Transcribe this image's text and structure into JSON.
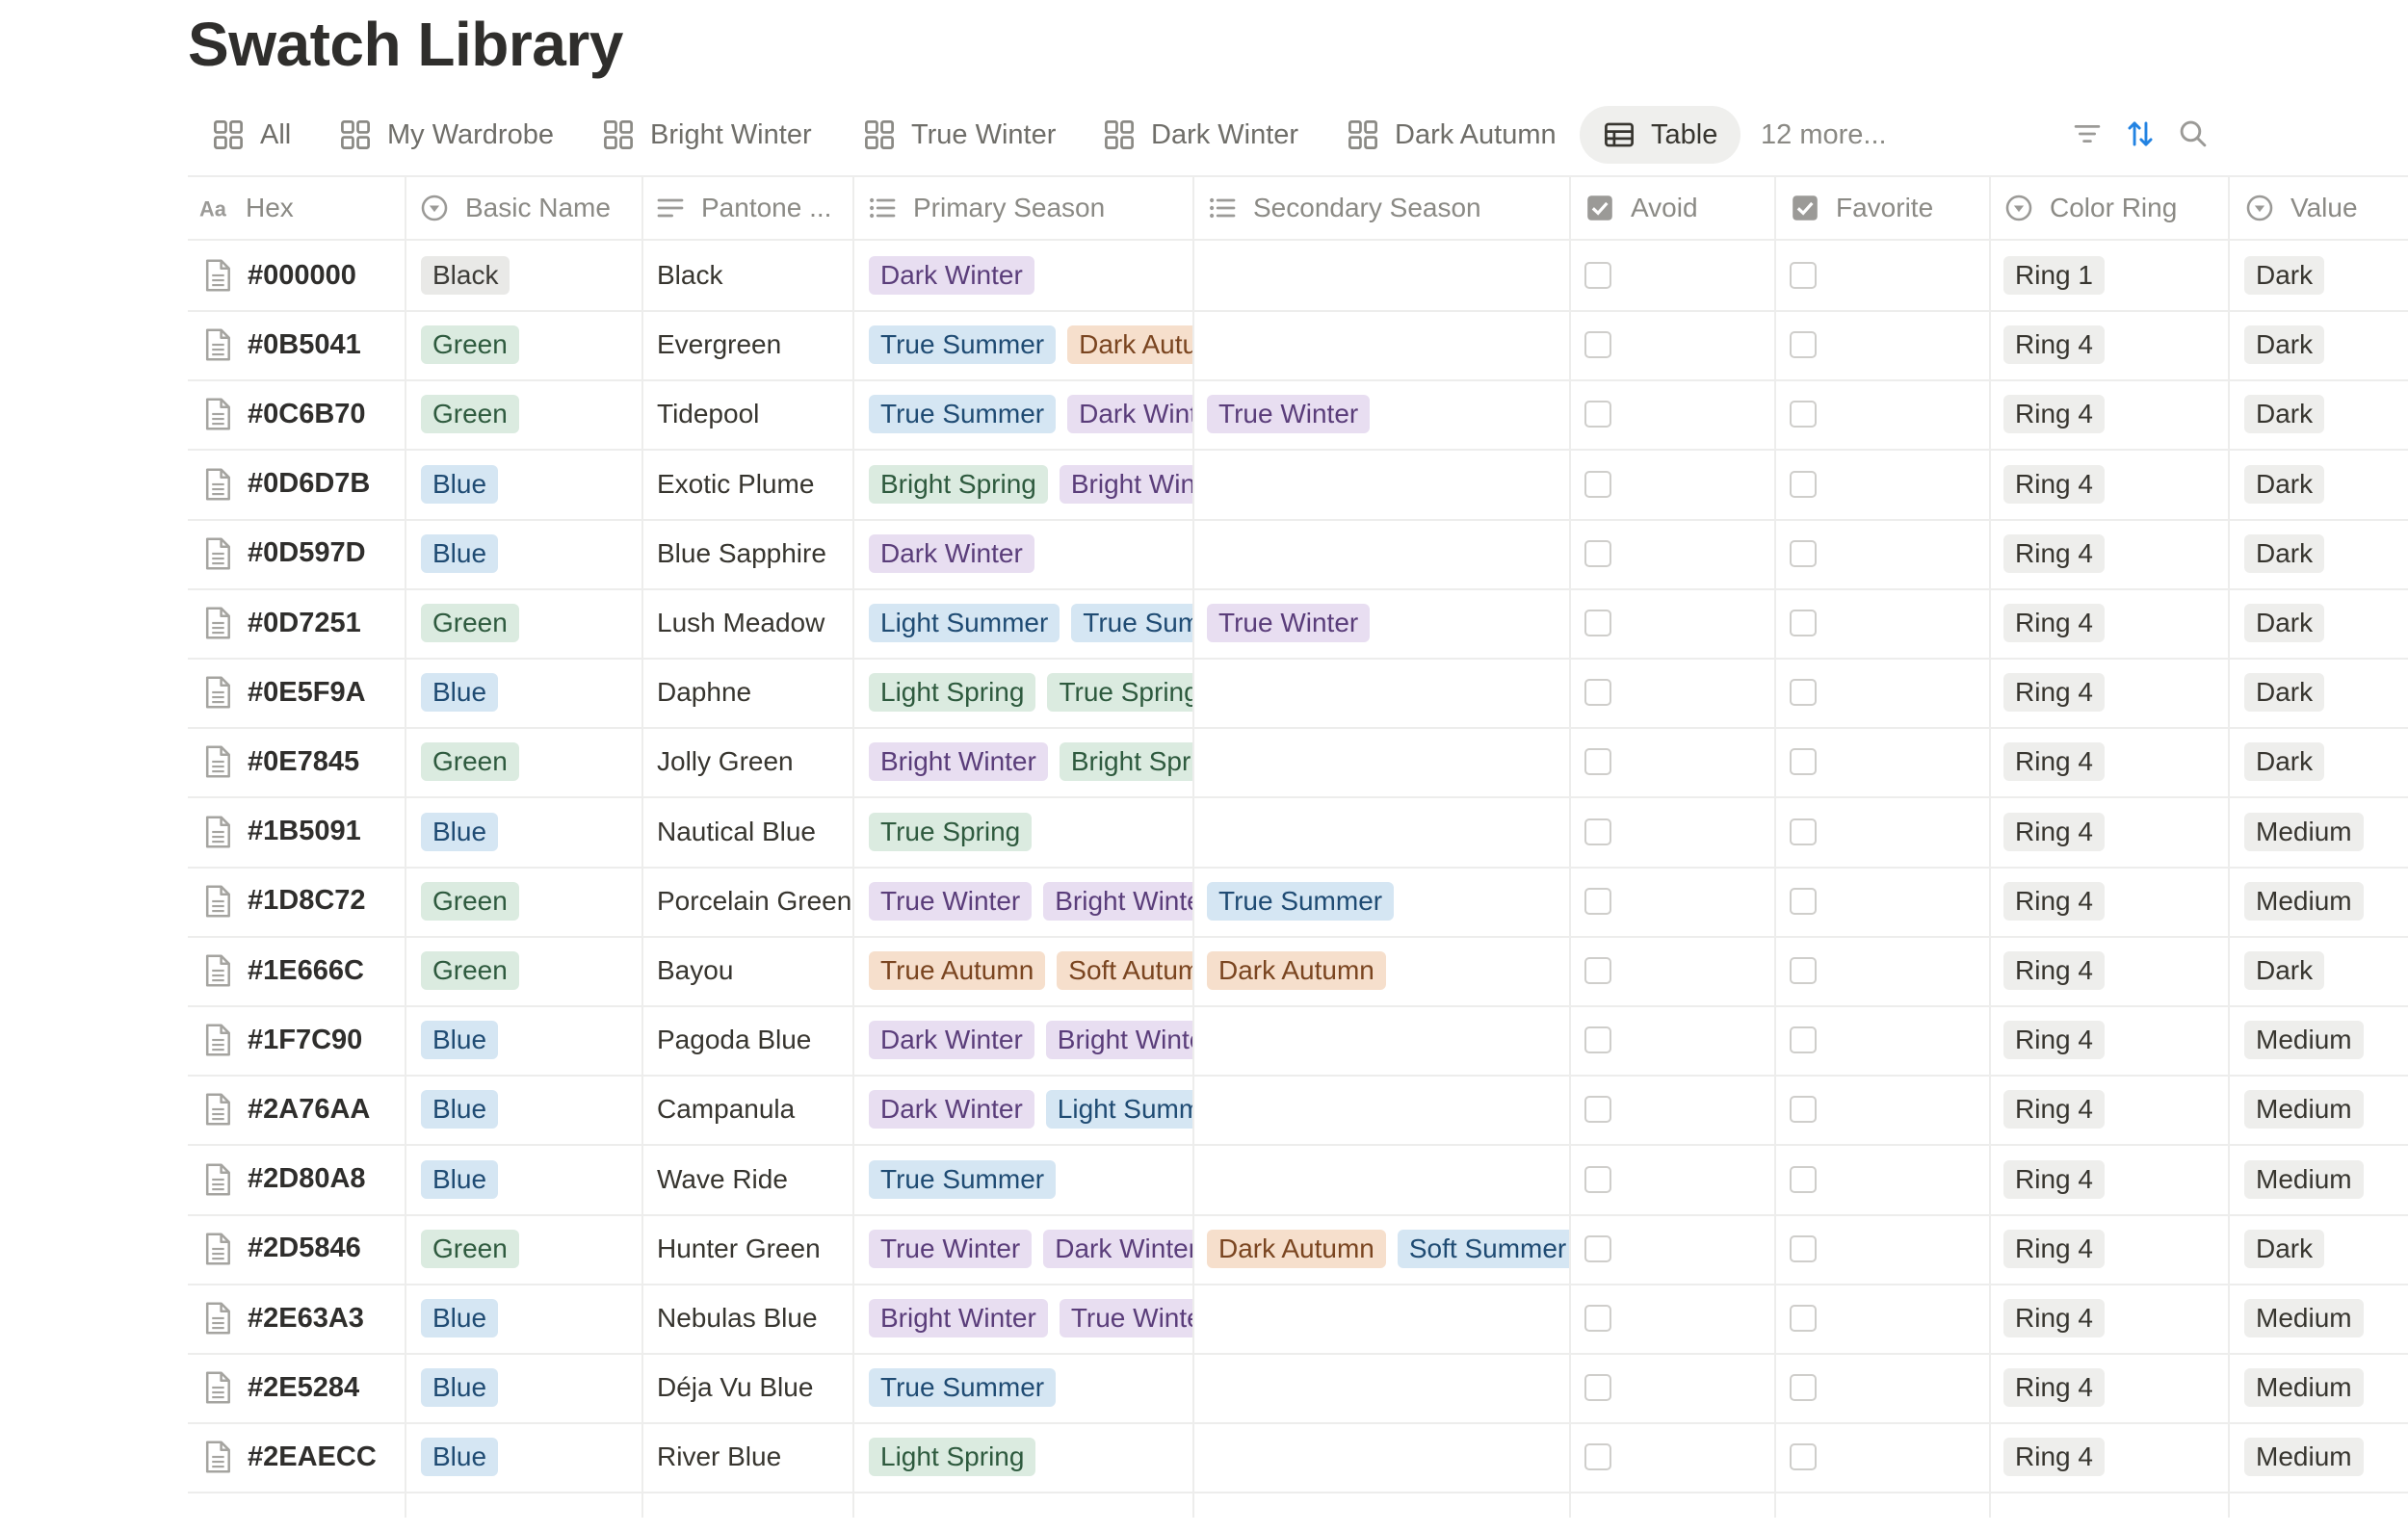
{
  "page": {
    "title": "Swatch Library"
  },
  "views": {
    "tabs": [
      "All",
      "My Wardrobe",
      "Bright Winter",
      "True Winter",
      "Dark Winter",
      "Dark Autumn"
    ],
    "active": "Table",
    "more": "12 more..."
  },
  "columns": {
    "hex": "Hex",
    "basic_name": "Basic Name",
    "pantone": "Pantone ...",
    "primary_season": "Primary Season",
    "secondary_season": "Secondary Season",
    "avoid": "Avoid",
    "favorite": "Favorite",
    "color_ring": "Color Ring",
    "value": "Value"
  },
  "colors": {
    "green": "#dbebe0",
    "blue": "#d5e6f3",
    "gray": "#e9e9e7",
    "purple": "#e8def1",
    "orange": "#f6dfcc",
    "accent": "#2383e2"
  },
  "rows": [
    {
      "hex": "#000000",
      "basic": "Black",
      "pantone": "Black",
      "primary": [
        "Dark Winter"
      ],
      "secondary": [],
      "ring": "Ring 1",
      "value": "Dark"
    },
    {
      "hex": "#0B5041",
      "basic": "Green",
      "pantone": "Evergreen",
      "primary": [
        "True Summer",
        "Dark Autumn"
      ],
      "secondary": [],
      "ring": "Ring 4",
      "value": "Dark"
    },
    {
      "hex": "#0C6B70",
      "basic": "Green",
      "pantone": "Tidepool",
      "primary": [
        "True Summer",
        "Dark Winter"
      ],
      "secondary": [
        "True Winter"
      ],
      "ring": "Ring 4",
      "value": "Dark"
    },
    {
      "hex": "#0D6D7B",
      "basic": "Blue",
      "pantone": "Exotic Plume",
      "primary": [
        "Bright Spring",
        "Bright Winter"
      ],
      "secondary": [],
      "ring": "Ring 4",
      "value": "Dark"
    },
    {
      "hex": "#0D597D",
      "basic": "Blue",
      "pantone": "Blue Sapphire",
      "primary": [
        "Dark Winter"
      ],
      "secondary": [],
      "ring": "Ring 4",
      "value": "Dark"
    },
    {
      "hex": "#0D7251",
      "basic": "Green",
      "pantone": "Lush Meadow",
      "primary": [
        "Light Summer",
        "True Summer"
      ],
      "secondary": [
        "True Winter"
      ],
      "ring": "Ring 4",
      "value": "Dark"
    },
    {
      "hex": "#0E5F9A",
      "basic": "Blue",
      "pantone": "Daphne",
      "primary": [
        "Light Spring",
        "True Spring"
      ],
      "secondary": [],
      "ring": "Ring 4",
      "value": "Dark"
    },
    {
      "hex": "#0E7845",
      "basic": "Green",
      "pantone": "Jolly Green",
      "primary": [
        "Bright Winter",
        "Bright Spring"
      ],
      "secondary": [],
      "ring": "Ring 4",
      "value": "Dark"
    },
    {
      "hex": "#1B5091",
      "basic": "Blue",
      "pantone": "Nautical Blue",
      "primary": [
        "True Spring"
      ],
      "secondary": [],
      "ring": "Ring 4",
      "value": "Medium"
    },
    {
      "hex": "#1D8C72",
      "basic": "Green",
      "pantone": "Porcelain Green",
      "primary": [
        "True Winter",
        "Bright Winter"
      ],
      "secondary": [
        "True Summer"
      ],
      "ring": "Ring 4",
      "value": "Medium"
    },
    {
      "hex": "#1E666C",
      "basic": "Green",
      "pantone": "Bayou",
      "primary": [
        "True Autumn",
        "Soft Autumn"
      ],
      "secondary": [
        "Dark Autumn"
      ],
      "ring": "Ring 4",
      "value": "Dark"
    },
    {
      "hex": "#1F7C90",
      "basic": "Blue",
      "pantone": "Pagoda Blue",
      "primary": [
        "Dark Winter",
        "Bright Winter"
      ],
      "secondary": [],
      "ring": "Ring 4",
      "value": "Medium"
    },
    {
      "hex": "#2A76AA",
      "basic": "Blue",
      "pantone": "Campanula",
      "primary": [
        "Dark Winter",
        "Light Summer"
      ],
      "secondary": [],
      "ring": "Ring 4",
      "value": "Medium"
    },
    {
      "hex": "#2D80A8",
      "basic": "Blue",
      "pantone": "Wave Ride",
      "primary": [
        "True Summer"
      ],
      "secondary": [],
      "ring": "Ring 4",
      "value": "Medium"
    },
    {
      "hex": "#2D5846",
      "basic": "Green",
      "pantone": "Hunter Green",
      "primary": [
        "True Winter",
        "Dark Winter"
      ],
      "secondary": [
        "Dark Autumn",
        "Soft Summer"
      ],
      "ring": "Ring 4",
      "value": "Dark"
    },
    {
      "hex": "#2E63A3",
      "basic": "Blue",
      "pantone": "Nebulas Blue",
      "primary": [
        "Bright Winter",
        "True Winter"
      ],
      "secondary": [],
      "ring": "Ring 4",
      "value": "Medium"
    },
    {
      "hex": "#2E5284",
      "basic": "Blue",
      "pantone": "Déja Vu Blue",
      "primary": [
        "True Summer"
      ],
      "secondary": [],
      "ring": "Ring 4",
      "value": "Medium"
    },
    {
      "hex": "#2EAECC",
      "basic": "Blue",
      "pantone": "River Blue",
      "primary": [
        "Light Spring"
      ],
      "secondary": [],
      "ring": "Ring 4",
      "value": "Medium"
    }
  ]
}
